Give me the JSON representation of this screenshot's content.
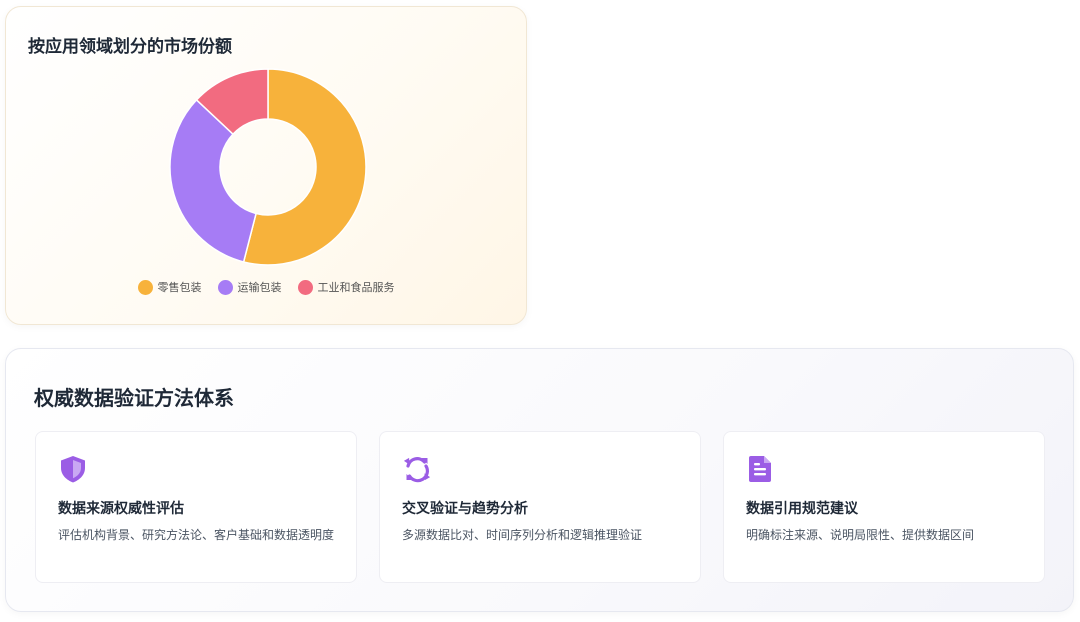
{
  "chart_data": {
    "type": "pie",
    "title": "按应用领域划分的市场份额",
    "categories": [
      "零售包装",
      "运输包装",
      "工业和食品服务"
    ],
    "values": [
      54,
      33,
      13
    ],
    "colors": [
      "#f7b23b",
      "#a67cf5",
      "#f26b80"
    ],
    "legend_position": "bottom",
    "donut": true
  },
  "methods": {
    "title": "权威数据验证方法体系",
    "cards": [
      {
        "icon": "shield-icon",
        "title": "数据来源权威性评估",
        "desc": "评估机构背景、研究方法论、客户基础和数据透明度"
      },
      {
        "icon": "refresh-icon",
        "title": "交叉验证与趋势分析",
        "desc": "多源数据比对、时间序列分析和逻辑推理验证"
      },
      {
        "icon": "document-icon",
        "title": "数据引用规范建议",
        "desc": "明确标注来源、说明局限性、提供数据区间"
      }
    ],
    "icon_color": "#9b5de5"
  }
}
